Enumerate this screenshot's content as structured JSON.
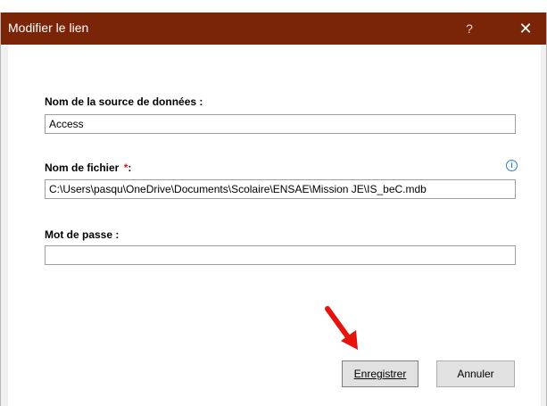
{
  "dialog": {
    "title": "Modifier le lien",
    "help_label": "?",
    "close_label": "✕"
  },
  "form": {
    "source_name_label": "Nom de la source de données :",
    "source_name_value": "Access",
    "file_name_label": "Nom de fichier",
    "file_name_required": "*",
    "file_name_suffix": ":",
    "file_name_value": "C:\\Users\\pasqu\\OneDrive\\Documents\\Scolaire\\ENSAE\\Mission JE\\IS_beC.mdb",
    "password_label": "Mot de passe :",
    "password_value": "",
    "info_icon_glyph": "i"
  },
  "buttons": {
    "save_label": "Enregistrer",
    "cancel_label": "Annuler"
  },
  "colors": {
    "titlebar": "#7b2508",
    "arrow": "#e8120c",
    "info": "#2a7fd4"
  }
}
